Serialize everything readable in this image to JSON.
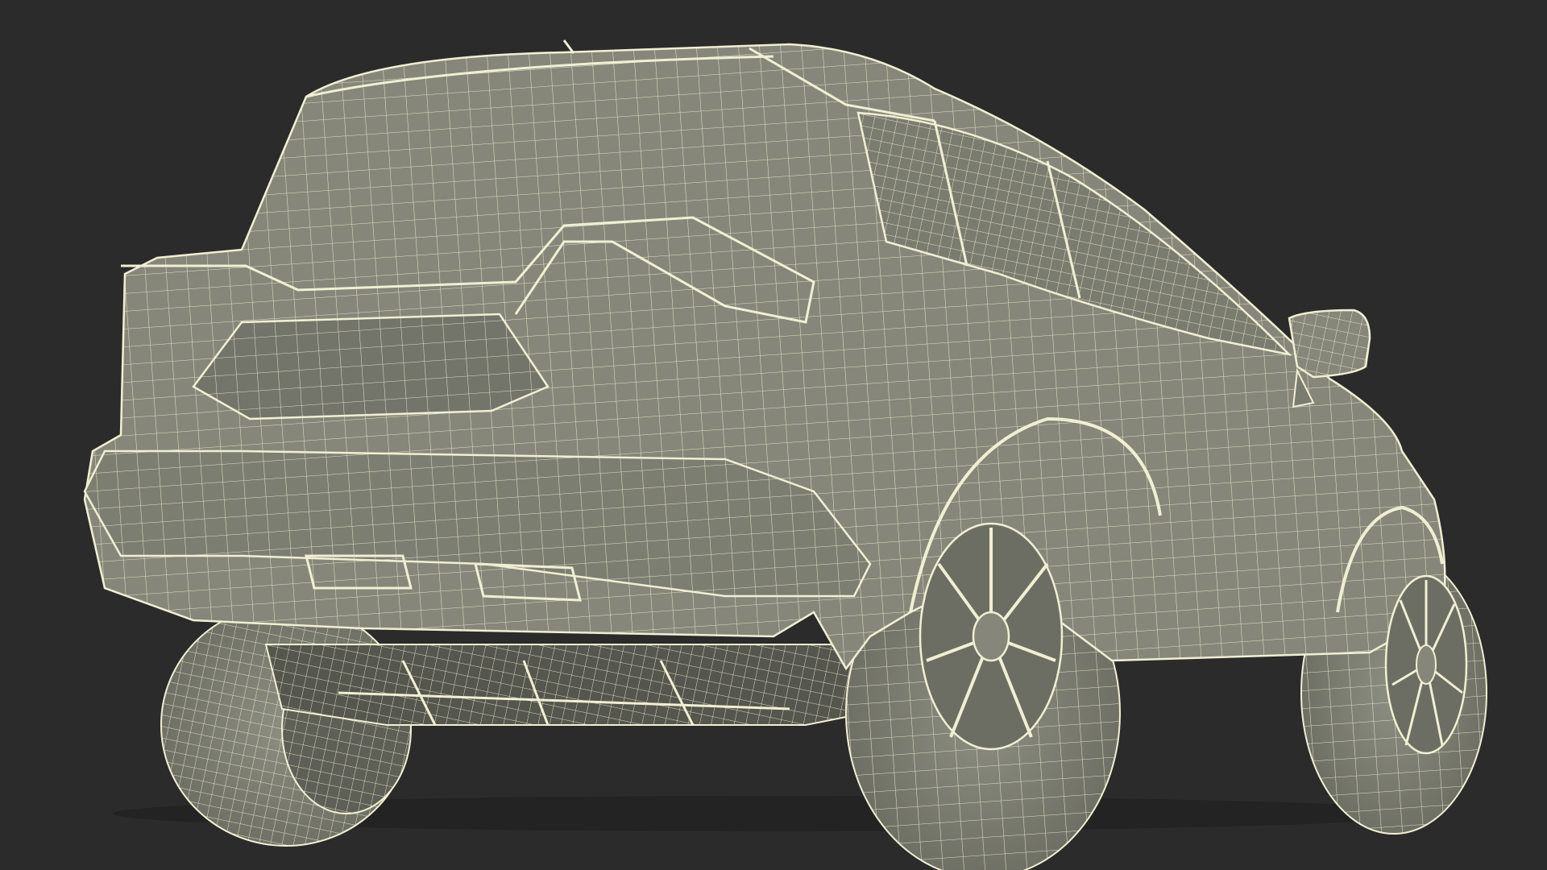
{
  "scene": {
    "subject": "wireframe-suv-rear-three-quarter",
    "background_color": "#2b2b2b",
    "body_fill": "#86877a",
    "body_shade": "#6f7064",
    "tire_fill": "#7c7d72",
    "wire_color": "#f1efd3"
  }
}
